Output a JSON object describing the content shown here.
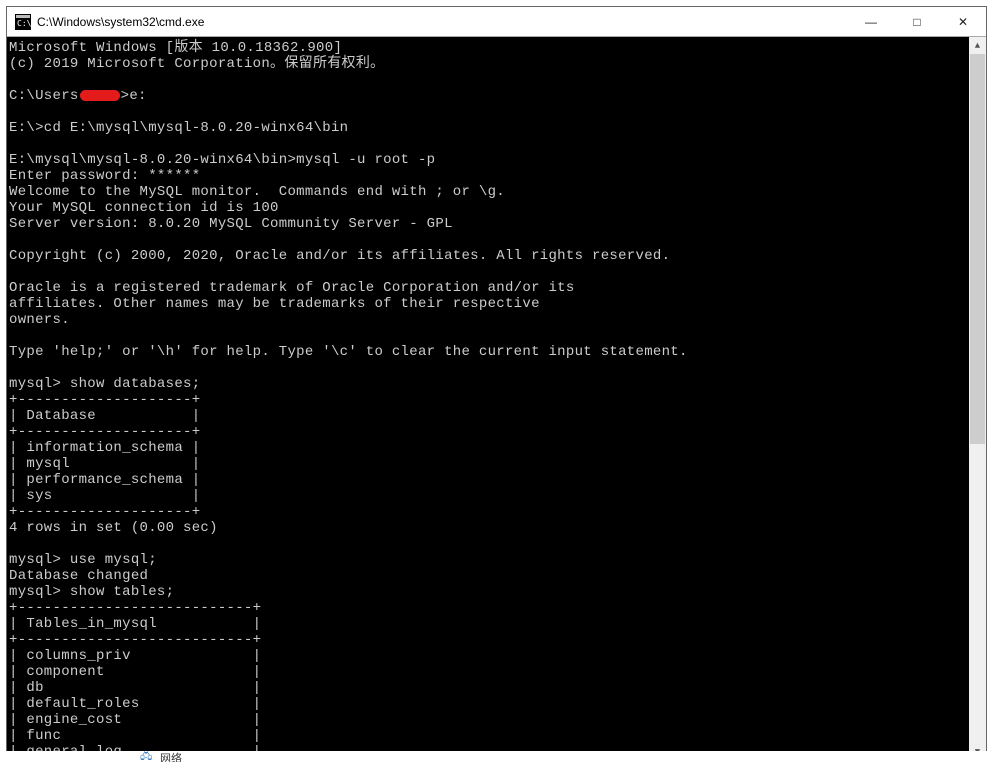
{
  "window": {
    "title": "C:\\Windows\\system32\\cmd.exe",
    "minimize": "—",
    "maximize": "□",
    "close": "✕"
  },
  "terminal": {
    "l01": "Microsoft Windows [版本 10.0.18362.900]",
    "l02": "(c) 2019 Microsoft Corporation。保留所有权利。",
    "l03": "",
    "l04a": "C:\\Users",
    "l04b": ">e:",
    "l05": "",
    "l06": "E:\\>cd E:\\mysql\\mysql-8.0.20-winx64\\bin",
    "l07": "",
    "l08": "E:\\mysql\\mysql-8.0.20-winx64\\bin>mysql -u root -p",
    "l09": "Enter password: ******",
    "l10": "Welcome to the MySQL monitor.  Commands end with ; or \\g.",
    "l11": "Your MySQL connection id is 100",
    "l12": "Server version: 8.0.20 MySQL Community Server - GPL",
    "l13": "",
    "l14": "Copyright (c) 2000, 2020, Oracle and/or its affiliates. All rights reserved.",
    "l15": "",
    "l16": "Oracle is a registered trademark of Oracle Corporation and/or its",
    "l17": "affiliates. Other names may be trademarks of their respective",
    "l18": "owners.",
    "l19": "",
    "l20": "Type 'help;' or '\\h' for help. Type '\\c' to clear the current input statement.",
    "l21": "",
    "l22": "mysql> show databases;",
    "l23": "+--------------------+",
    "l24": "| Database           |",
    "l25": "+--------------------+",
    "l26": "| information_schema |",
    "l27": "| mysql              |",
    "l28": "| performance_schema |",
    "l29": "| sys                |",
    "l30": "+--------------------+",
    "l31": "4 rows in set (0.00 sec)",
    "l32": "",
    "l33": "mysql> use mysql;",
    "l34": "Database changed",
    "l35": "mysql> show tables;",
    "l36": "+---------------------------+",
    "l37": "| Tables_in_mysql           |",
    "l38": "+---------------------------+",
    "l39": "| columns_priv              |",
    "l40": "| component                 |",
    "l41": "| db                        |",
    "l42": "| default_roles             |",
    "l43": "| engine_cost               |",
    "l44": "| func                      |",
    "l45": "| general_log               |"
  },
  "taskbar": {
    "net": "网络"
  }
}
